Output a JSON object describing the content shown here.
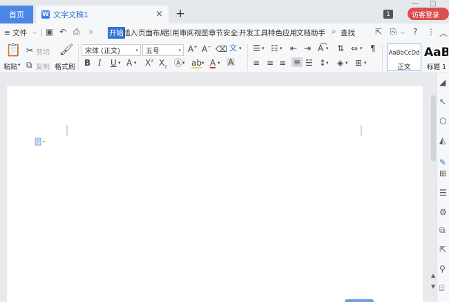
{
  "titlebar": {
    "home_tab": "首页",
    "doc_tab": "文字文稿1",
    "doc_icon": "W",
    "close_glyph": "×",
    "add_glyph": "+",
    "badge": "1",
    "login": "访客登录"
  },
  "menubar": {
    "file": "≡ 文件",
    "tabs": [
      "开始",
      "插入",
      "页面布局",
      "引用",
      "审阅",
      "视图",
      "章节",
      "安全",
      "开发工具",
      "特色应用",
      "文档助手"
    ],
    "active_tab": "开始",
    "search": "查找"
  },
  "ribbon": {
    "paste": "粘贴",
    "cut": "剪切",
    "copy": "复制",
    "format_painter": "格式刷",
    "font_name": "宋体 (正文)",
    "font_size": "五号",
    "styles": [
      {
        "sample": "AaBbCcDd",
        "name": "正文"
      },
      {
        "sample": "AaB",
        "name": "标题 1"
      }
    ]
  },
  "colors": {
    "accent": "#3472d9",
    "home_tab": "#4a86e8",
    "login": "#d94f4f"
  }
}
